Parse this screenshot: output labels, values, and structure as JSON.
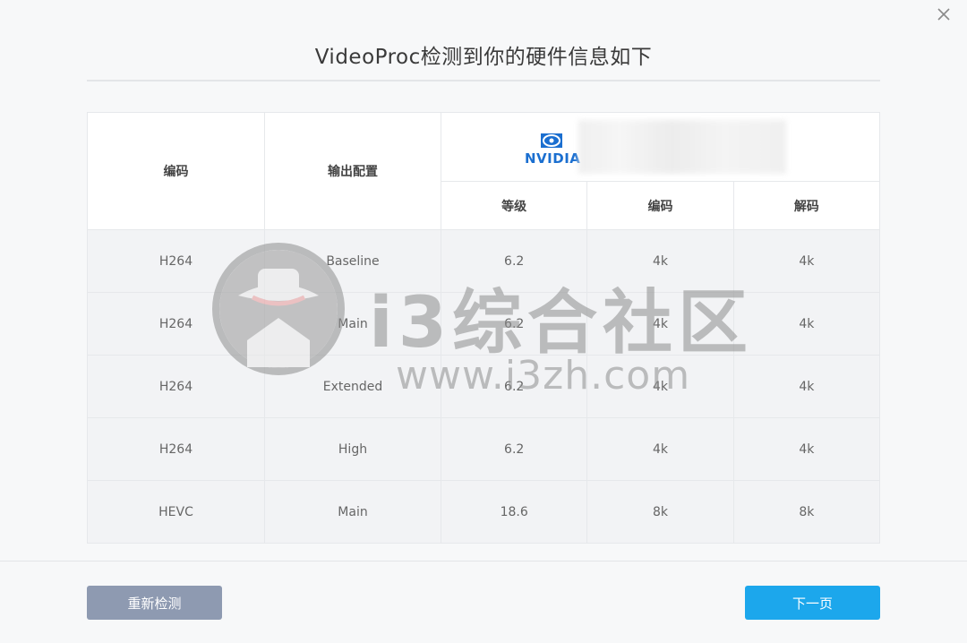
{
  "window": {
    "title": "VideoProc检测到你的硬件信息如下"
  },
  "icons": {
    "close": "close-icon",
    "gpu_logo": "nvidia-logo-icon"
  },
  "table": {
    "header": {
      "col1": "编码",
      "col2": "输出配置",
      "gpu_brand": "NVIDIA",
      "sub": [
        "等级",
        "编码",
        "解码"
      ]
    },
    "rows": [
      {
        "codec": "H264",
        "profile": "Baseline",
        "level": "6.2",
        "encode": "4k",
        "decode": "4k"
      },
      {
        "codec": "H264",
        "profile": "Main",
        "level": "6.2",
        "encode": "4k",
        "decode": "4k"
      },
      {
        "codec": "H264",
        "profile": "Extended",
        "level": "6.2",
        "encode": "4k",
        "decode": "4k"
      },
      {
        "codec": "H264",
        "profile": "High",
        "level": "6.2",
        "encode": "4k",
        "decode": "4k"
      },
      {
        "codec": "HEVC",
        "profile": "Main",
        "level": "18.6",
        "encode": "8k",
        "decode": "8k"
      }
    ]
  },
  "buttons": {
    "redetect": "重新检测",
    "next": "下一页"
  },
  "watermark": {
    "site": "i3综合社区",
    "url": "www.i3zh.com"
  },
  "colors": {
    "accent": "#1ca7ec",
    "secondary_button": "#8e9ab1",
    "nvidia_green": "#76b900",
    "nvidia_text": "#1b6fd0"
  }
}
